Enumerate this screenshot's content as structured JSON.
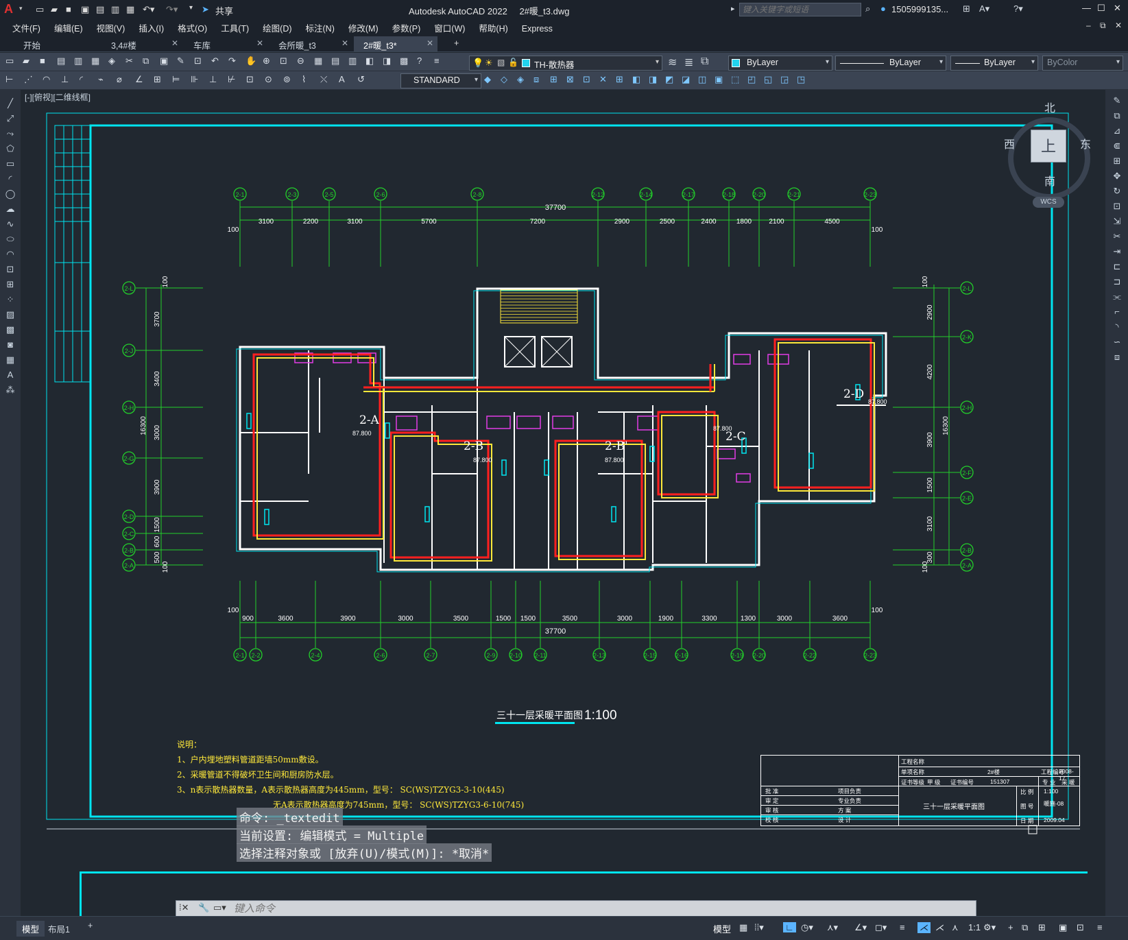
{
  "app": {
    "title": "Autodesk AutoCAD 2022",
    "filename": "2#暖_t3.dwg",
    "share_label": "共享",
    "search_placeholder": "键入关键字或短语",
    "user": "1505999135..."
  },
  "menu": [
    "文件(F)",
    "编辑(E)",
    "视图(V)",
    "插入(I)",
    "格式(O)",
    "工具(T)",
    "绘图(D)",
    "标注(N)",
    "修改(M)",
    "参数(P)",
    "窗口(W)",
    "帮助(H)",
    "Express"
  ],
  "tabs": [
    {
      "label": "开始"
    },
    {
      "label": "3,4#楼"
    },
    {
      "label": "车库"
    },
    {
      "label": "会所暖_t3"
    },
    {
      "label": "2#暖_t3*"
    }
  ],
  "toolbar": {
    "layer": "TH-散热器",
    "color": "ByLayer",
    "linetype": "ByLayer",
    "lineweight": "ByLayer",
    "plotstyle": "ByColor",
    "textstyle": "STANDARD"
  },
  "colors": {
    "canvas": "#212830",
    "frame": "#00e5f0",
    "grid": "#22d02a",
    "wall": "#ffffff",
    "pipe_supply": "#ff1f1f",
    "pipe_return": "#ffe93a",
    "fixtures": "#e23ce6",
    "notes": "#ffe93a"
  },
  "viewport_label": "[-][俯视][二维线框]",
  "viewcube": {
    "north": "北",
    "south": "南",
    "east": "东",
    "west": "西",
    "top": "上",
    "wcs": "WCS"
  },
  "drawing": {
    "top_axes": [
      "2-1",
      "2-3",
      "2-5",
      "2-6",
      "2-8",
      "2-12",
      "2-14",
      "2-17",
      "2-18",
      "2-20",
      "2-21",
      "2-23"
    ],
    "top_dims": [
      "3100",
      "2200",
      "3100",
      "5700",
      "7200",
      "2900",
      "2500",
      "2400",
      "1800",
      "2100",
      "4500"
    ],
    "top_total": "37700",
    "edge_dim": "100",
    "bottom_axes": [
      "2-1",
      "2-2",
      "2-4",
      "2-6",
      "2-7",
      "2-9",
      "2-10",
      "2-11",
      "2-13",
      "2-15",
      "2-16",
      "2-19",
      "2-20",
      "2-22",
      "2-23"
    ],
    "bottom_dims": [
      "900",
      "3600",
      "3900",
      "3000",
      "3500",
      "1500",
      "1500",
      "3500",
      "3000",
      "1900",
      "3300",
      "1300",
      "3000",
      "3600"
    ],
    "bottom_total": "37700",
    "left_axes": [
      "2-L",
      "2-J",
      "2-H",
      "2-G",
      "2-D",
      "2-C",
      "2-B",
      "2-A"
    ],
    "left_dims": [
      "3700",
      "3400",
      "3000",
      "3900",
      "1500",
      "600",
      "500"
    ],
    "side_total": "16300",
    "right_axes": [
      "2-L",
      "2-K",
      "2-H",
      "2-F",
      "2-E",
      "2-B",
      "2-A"
    ],
    "right_dims": [
      "2900",
      "4200",
      "3900",
      "1500",
      "3100",
      "300"
    ],
    "units": [
      "2-A",
      "2-B",
      "2-B'",
      "2-C",
      "2-D"
    ],
    "elevation": "87.800",
    "title": "三十一层采暖平面图",
    "scale": "1:100"
  },
  "notes": {
    "heading": "说明：",
    "items": [
      "1、户内埋地塑料管道距墙50mm敷设。",
      "2、采暖管道不得破坏卫生间和厨房防水层。",
      "3、n表示散热器数量，A表示散热器高度为445mm，型号： SC(WS)TZYG3-3-10(445)",
      "无A表示散热器高度为745mm，型号： SC(WS)TZYG3-6-10(745)"
    ]
  },
  "titleblock": {
    "project": "工程名称",
    "item": "单项名称",
    "building": "2#楼",
    "job_no_label": "工程编号",
    "job_no": "2008-17",
    "cert_level": "证书等级",
    "grade": "甲 级",
    "cert_no_label": "证书编号",
    "cert_no": "151307",
    "roles": [
      "批 准",
      "审 定",
      "审 核",
      "校 核"
    ],
    "roles2": [
      "项目负责",
      "专业负责",
      "方 案",
      "设 计"
    ],
    "drawing_name": "三十一层采暖平面图",
    "specialty_label": "专 业",
    "specialty": "采 暖",
    "scale_label": "比 例",
    "scale": "1:100",
    "sheet_label": "图 号",
    "sheet": "暖施-08",
    "date_label": "日 期",
    "date": "2009.04"
  },
  "command": {
    "history": [
      "命令: _textedit",
      "当前设置: 编辑模式 = Multiple",
      "选择注释对象或 [放弃(U)/模式(M)]: *取消*"
    ],
    "placeholder": "键入命令"
  },
  "status": {
    "layout_tabs": [
      "模型",
      "布局1"
    ],
    "model_label": "模型",
    "scale": "1:1"
  }
}
